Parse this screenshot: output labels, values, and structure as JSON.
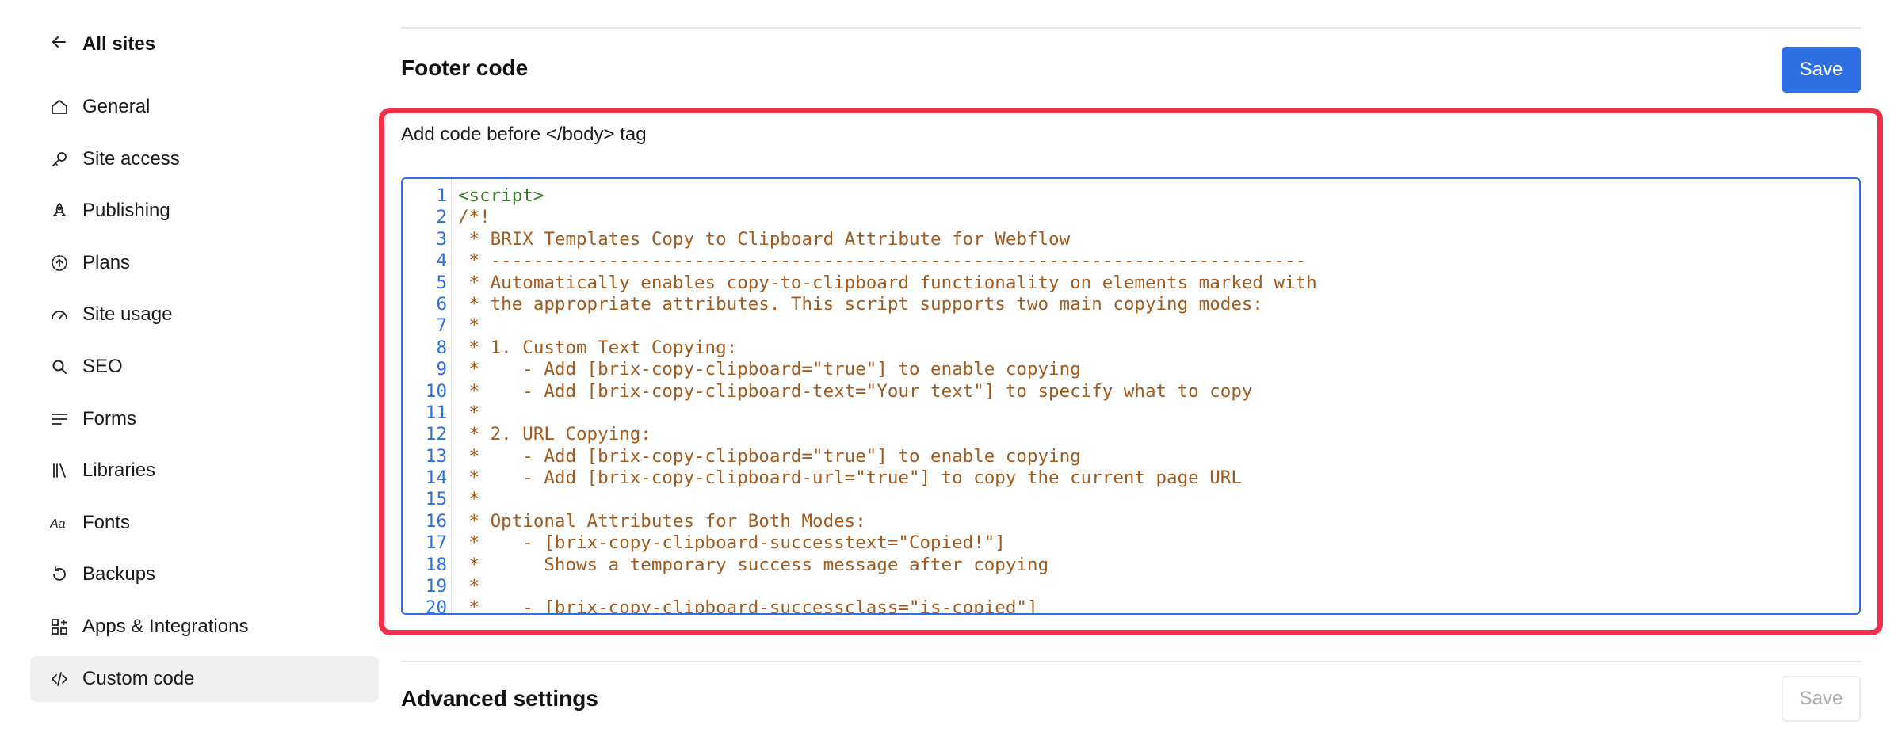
{
  "sidebar": {
    "back_label": "All sites",
    "items": [
      {
        "label": "General",
        "icon": "home-icon"
      },
      {
        "label": "Site access",
        "icon": "key-icon"
      },
      {
        "label": "Publishing",
        "icon": "rocket-icon"
      },
      {
        "label": "Plans",
        "icon": "upgrade-icon"
      },
      {
        "label": "Site usage",
        "icon": "gauge-icon"
      },
      {
        "label": "SEO",
        "icon": "search-icon"
      },
      {
        "label": "Forms",
        "icon": "lines-icon"
      },
      {
        "label": "Libraries",
        "icon": "library-icon"
      },
      {
        "label": "Fonts",
        "icon": "font-icon"
      },
      {
        "label": "Backups",
        "icon": "restore-icon"
      },
      {
        "label": "Apps & Integrations",
        "icon": "apps-icon"
      },
      {
        "label": "Custom code",
        "icon": "code-icon",
        "active": true
      }
    ]
  },
  "footer_code": {
    "title": "Footer code",
    "save_label": "Save",
    "field_label": "Add code before </body> tag",
    "lines": [
      "<script>",
      "/*!",
      " * BRIX Templates Copy to Clipboard Attribute for Webflow",
      " * ----------------------------------------------------------------------------",
      " * Automatically enables copy-to-clipboard functionality on elements marked with",
      " * the appropriate attributes. This script supports two main copying modes:",
      " *",
      " * 1. Custom Text Copying:",
      " *    - Add [brix-copy-clipboard=\"true\"] to enable copying",
      " *    - Add [brix-copy-clipboard-text=\"Your text\"] to specify what to copy",
      " *",
      " * 2. URL Copying:",
      " *    - Add [brix-copy-clipboard=\"true\"] to enable copying",
      " *    - Add [brix-copy-clipboard-url=\"true\"] to copy the current page URL",
      " *",
      " * Optional Attributes for Both Modes:",
      " *    - [brix-copy-clipboard-successtext=\"Copied!\"]",
      " *      Shows a temporary success message after copying",
      " *",
      " *    - [brix-copy-clipboard-successclass=\"is-copied\"]"
    ]
  },
  "advanced_settings": {
    "title": "Advanced settings",
    "save_label": "Save"
  },
  "colors": {
    "accent": "#2f6fe4",
    "highlight": "#f0304a",
    "code_comment": "#a35a1c",
    "code_tag": "#3a7a2a",
    "line_number": "#2f6fe4"
  }
}
